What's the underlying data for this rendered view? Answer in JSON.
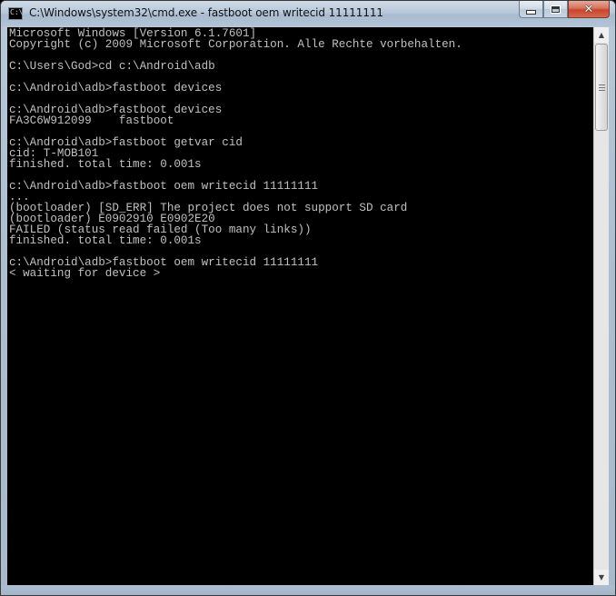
{
  "window": {
    "title": "C:\\Windows\\system32\\cmd.exe - fastboot  oem writecid 11111111",
    "icon_name": "cmd-icon",
    "icon_glyph": "C:\\",
    "buttons": {
      "minimize": "minimize-icon",
      "maximize": "maximize-icon",
      "close": "close-icon",
      "close_glyph": "✕"
    }
  },
  "console": {
    "background": "#000000",
    "foreground": "#c0c0c0",
    "lines": [
      "Microsoft Windows [Version 6.1.7601]",
      "Copyright (c) 2009 Microsoft Corporation. Alle Rechte vorbehalten.",
      "",
      "C:\\Users\\God>cd c:\\Android\\adb",
      "",
      "c:\\Android\\adb>fastboot devices",
      "",
      "c:\\Android\\adb>fastboot devices",
      "FA3C6W912099    fastboot",
      "",
      "c:\\Android\\adb>fastboot getvar cid",
      "cid: T-MOB101",
      "finished. total time: 0.001s",
      "",
      "c:\\Android\\adb>fastboot oem writecid 11111111",
      "...",
      "(bootloader) [SD_ERR] The project does not support SD card",
      "(bootloader) E0902910 E0902E20",
      "FAILED (status read failed (Too many links))",
      "finished. total time: 0.001s",
      "",
      "c:\\Android\\adb>fastboot oem writecid 11111111",
      "< waiting for device >"
    ]
  },
  "scrollbar": {
    "up_arrow": "▲",
    "down_arrow": "▼"
  }
}
